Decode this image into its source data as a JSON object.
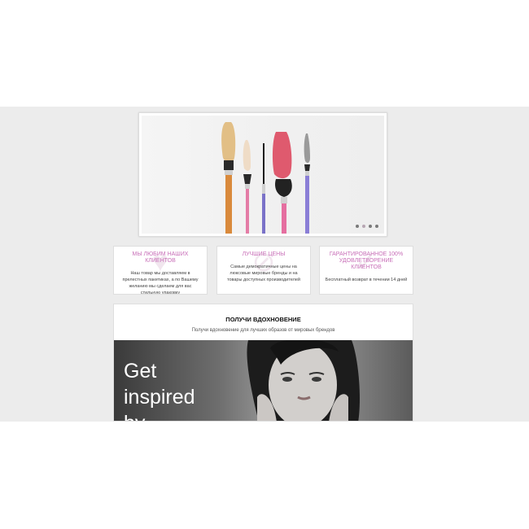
{
  "slider": {
    "dots": [
      {
        "active": false
      },
      {
        "active": true
      },
      {
        "active": false
      },
      {
        "active": false
      }
    ]
  },
  "features": [
    {
      "title": "МЫ ЛЮБИМ НАШИХ КЛИЕНТОВ",
      "text": "Наш товар мы доставляем в прелестных пакетиках, а по Вашему желанию мы сделаем для вас стильную упаковку"
    },
    {
      "title": "ЛУЧШИЕ ЦЕНЫ",
      "text": "Самые демократичные цены на люксовые мировые бренды и на товары доступных производителей"
    },
    {
      "title": "ГАРАНТИРОВАННОЕ 100% УДОВЛЕТВОРЕНИЕ КЛИЕНТОВ",
      "text": "Бесплатный возврат в течении 14 дней"
    }
  ],
  "inspiration": {
    "title": "ПОЛУЧИ ВДОХНОВЕНИЕ",
    "subtitle": "Получи вдохновение для лучших образов от мировых брендов",
    "image_text": "Get\ninspired\nby"
  },
  "colors": {
    "accent": "#c86fb8",
    "band": "#ececec"
  }
}
